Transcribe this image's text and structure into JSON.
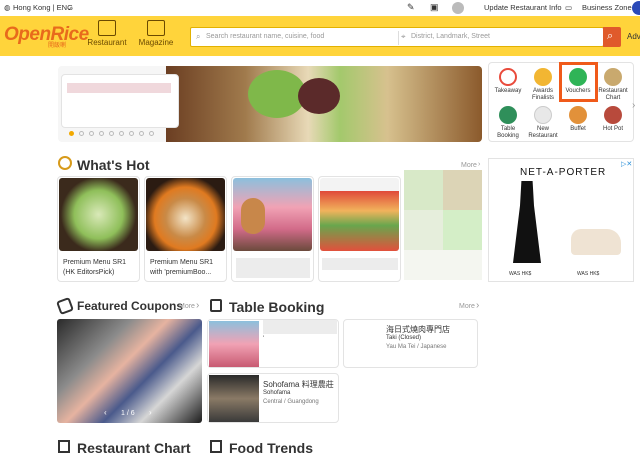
{
  "topbar": {
    "region": "Hong Kong | ENG",
    "update_label": "Update Restaurant Info",
    "business_label": "Business Zone"
  },
  "header": {
    "logo": "OpenRice",
    "logo_sub": "開飯喇",
    "nav": [
      "Restaurant",
      "Magazine"
    ],
    "search_placeholder": "Search restaurant name, cuisine, food",
    "location_placeholder": "District, Landmark, Street",
    "advance_label": "Adv"
  },
  "categories": [
    {
      "label": "Takeaway",
      "color": "#e94b3c"
    },
    {
      "label": "Awards Finalists",
      "color": "#f2b632"
    },
    {
      "label": "Vouchers",
      "color": "#2fb457"
    },
    {
      "label": "Restaurant Chart",
      "color": "#c9a96e"
    },
    {
      "label": "Table Booking",
      "color": "#2f8f5a"
    },
    {
      "label": "New Restaurant",
      "color": "#d6d6d6"
    },
    {
      "label": "Buffet",
      "color": "#e2913a"
    },
    {
      "label": "Hot Pot",
      "color": "#b84a3c"
    }
  ],
  "whats_hot": {
    "title": "What's Hot",
    "more": "More",
    "items": [
      {
        "label": "Premium Menu SR1 (HK EditorsPick)"
      },
      {
        "label": "Premium Menu SR1 with 'premiumBoo..."
      },
      {
        "label": ""
      },
      {
        "label": ""
      }
    ]
  },
  "ad": {
    "brand": "NET-A-PORTER",
    "was1": "WAS HK$",
    "was2": "WAS HK$"
  },
  "coupons": {
    "title": "Featured Coupons",
    "more": "More",
    "pager": "1 / 6"
  },
  "booking": {
    "title": "Table Booking",
    "more": "More",
    "items": [
      {
        "name": "",
        "sub": "",
        "meta": ""
      },
      {
        "name": "海日式燒肉專門店",
        "sub": "Taki (Closed)",
        "meta": "Yau Ma Tei / Japanese"
      },
      {
        "name": "Sohofama 料理農莊",
        "sub": "Sohofama",
        "meta": "Central / Guangdong"
      }
    ]
  },
  "footer_sections": [
    "Restaurant Chart",
    "Food Trends"
  ]
}
